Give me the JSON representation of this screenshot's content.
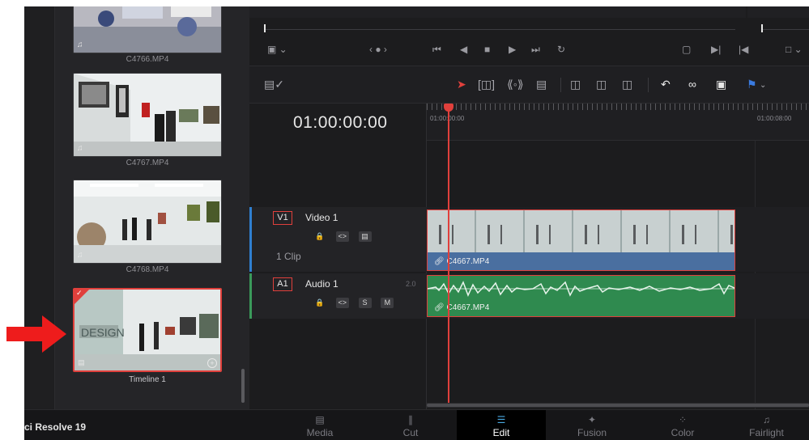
{
  "media_pool": {
    "clips": [
      {
        "name": "C4766.MP4",
        "audio_icon": "music-note-icon"
      },
      {
        "name": "C4767.MP4",
        "audio_icon": "music-note-icon"
      },
      {
        "name": "C4768.MP4",
        "audio_icon": "music-note-icon"
      },
      {
        "name": "Timeline 1",
        "selected": true,
        "type": "timeline"
      }
    ]
  },
  "timeline": {
    "timecode": "01:00:00:00",
    "ruler_labels": [
      "01:00:00:00",
      "01:00:08:00"
    ],
    "video_track": {
      "id": "V1",
      "name": "Video 1",
      "clip_count": "1 Clip",
      "clip_name": "C4667.MP4"
    },
    "audio_track": {
      "id": "A1",
      "name": "Audio 1",
      "channels": "2.0",
      "clip_name": "C4667.MP4",
      "solo": "S",
      "mute": "M"
    }
  },
  "bottom_bar": {
    "app_name": "ci Resolve 19",
    "pages": [
      {
        "label": "Media",
        "icon": "media-page-icon"
      },
      {
        "label": "Cut",
        "icon": "cut-page-icon"
      },
      {
        "label": "Edit",
        "icon": "edit-page-icon",
        "active": true
      },
      {
        "label": "Fusion",
        "icon": "fusion-page-icon"
      },
      {
        "label": "Color",
        "icon": "color-page-icon"
      },
      {
        "label": "Fairlight",
        "icon": "fairlight-page-icon"
      }
    ]
  },
  "colors": {
    "accent_red": "#e0403c",
    "video_blue": "#4a6fa0",
    "audio_green": "#2f8a4f",
    "active_tab_blue": "#4aa8e0"
  }
}
